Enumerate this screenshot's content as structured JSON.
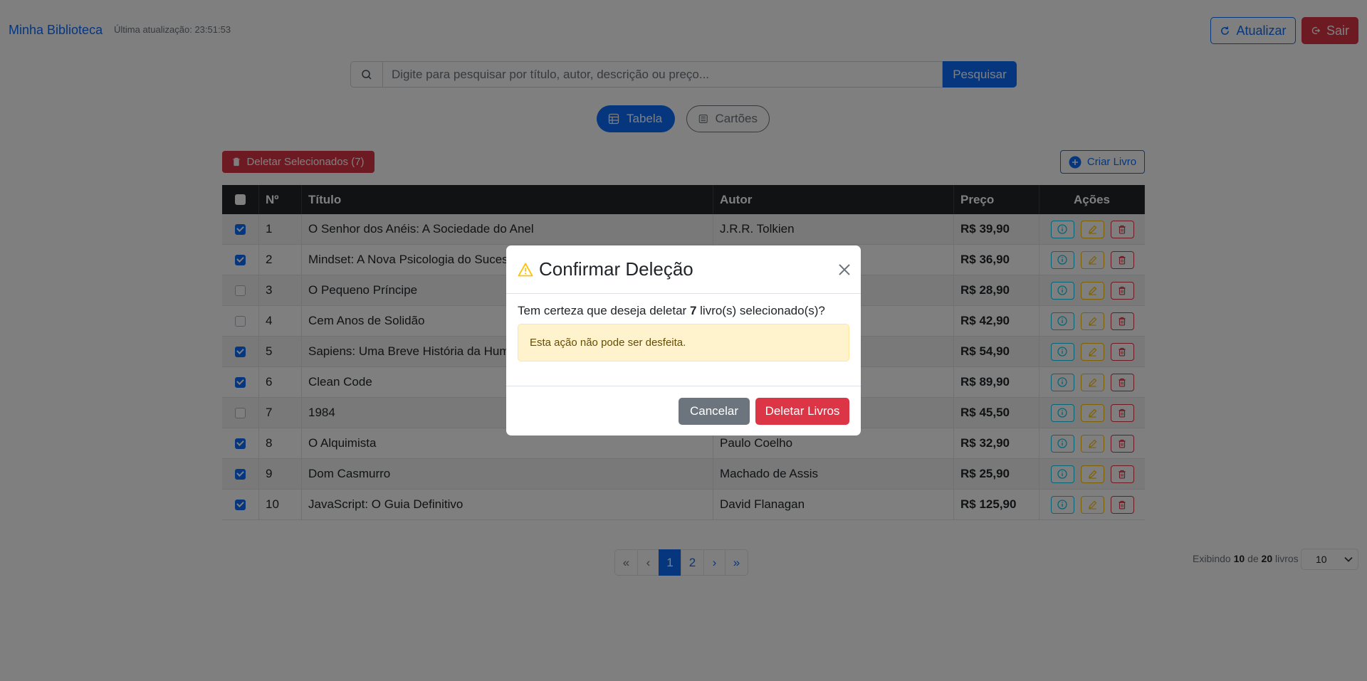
{
  "header": {
    "brand": "Minha Biblioteca",
    "last_update": "Última atualização: 23:51:53",
    "refresh_label": "Atualizar",
    "exit_label": "Sair"
  },
  "search": {
    "placeholder": "Digite para pesquisar por título, autor, descrição ou preço...",
    "button_label": "Pesquisar"
  },
  "view_toggle": {
    "table_label": "Tabela",
    "cards_label": "Cartões",
    "active": "Tabela"
  },
  "actions": {
    "delete_selected_label": "Deletar Selecionados (7)",
    "create_label": "Criar Livro"
  },
  "table": {
    "columns": [
      "Nº",
      "Título",
      "Autor",
      "Preço",
      "Ações"
    ],
    "rows": [
      {
        "checked": true,
        "num": "1",
        "title": "O Senhor dos Anéis: A Sociedade do Anel",
        "author": "J.R.R. Tolkien",
        "price": "R$ 39,90"
      },
      {
        "checked": true,
        "num": "2",
        "title": "Mindset: A Nova Psicologia do Sucesso",
        "author": "",
        "price": "R$ 36,90"
      },
      {
        "checked": false,
        "num": "3",
        "title": "O Pequeno Príncipe",
        "author": "",
        "price": "R$ 28,90"
      },
      {
        "checked": false,
        "num": "4",
        "title": "Cem Anos de Solidão",
        "author": "",
        "price": "R$ 42,90"
      },
      {
        "checked": true,
        "num": "5",
        "title": "Sapiens: Uma Breve História da Humanidade",
        "author": "",
        "price": "R$ 54,90"
      },
      {
        "checked": true,
        "num": "6",
        "title": "Clean Code",
        "author": "",
        "price": "R$ 89,90"
      },
      {
        "checked": false,
        "num": "7",
        "title": "1984",
        "author": "",
        "price": "R$ 45,50"
      },
      {
        "checked": true,
        "num": "8",
        "title": "O Alquimista",
        "author": "Paulo Coelho",
        "price": "R$ 32,90"
      },
      {
        "checked": true,
        "num": "9",
        "title": "Dom Casmurro",
        "author": "Machado de Assis",
        "price": "R$ 25,90"
      },
      {
        "checked": true,
        "num": "10",
        "title": "JavaScript: O Guia Definitivo",
        "author": "David Flanagan",
        "price": "R$ 125,90"
      }
    ]
  },
  "pagination": {
    "first": "«",
    "prev": "‹",
    "pages": [
      "1",
      "2"
    ],
    "current": "1",
    "next": "›",
    "last": "»"
  },
  "footer": {
    "showing_prefix": "Exibindo",
    "showing_count": "10",
    "showing_mid": "de",
    "showing_total": "20",
    "showing_suffix": "livros",
    "per_page": "10"
  },
  "modal": {
    "title": "Confirmar Deleção",
    "question_prefix": "Tem certeza que deseja deletar",
    "question_count": "7",
    "question_suffix": "livro(s) selecionado(s)?",
    "warning": "Esta ação não pode ser desfeita.",
    "cancel_label": "Cancelar",
    "confirm_label": "Deletar Livros"
  },
  "colors": {
    "primary": "#0d6efd",
    "danger": "#dc3545",
    "warning": "#ffc107",
    "info": "#0dcaf0",
    "secondary": "#6c757d"
  }
}
